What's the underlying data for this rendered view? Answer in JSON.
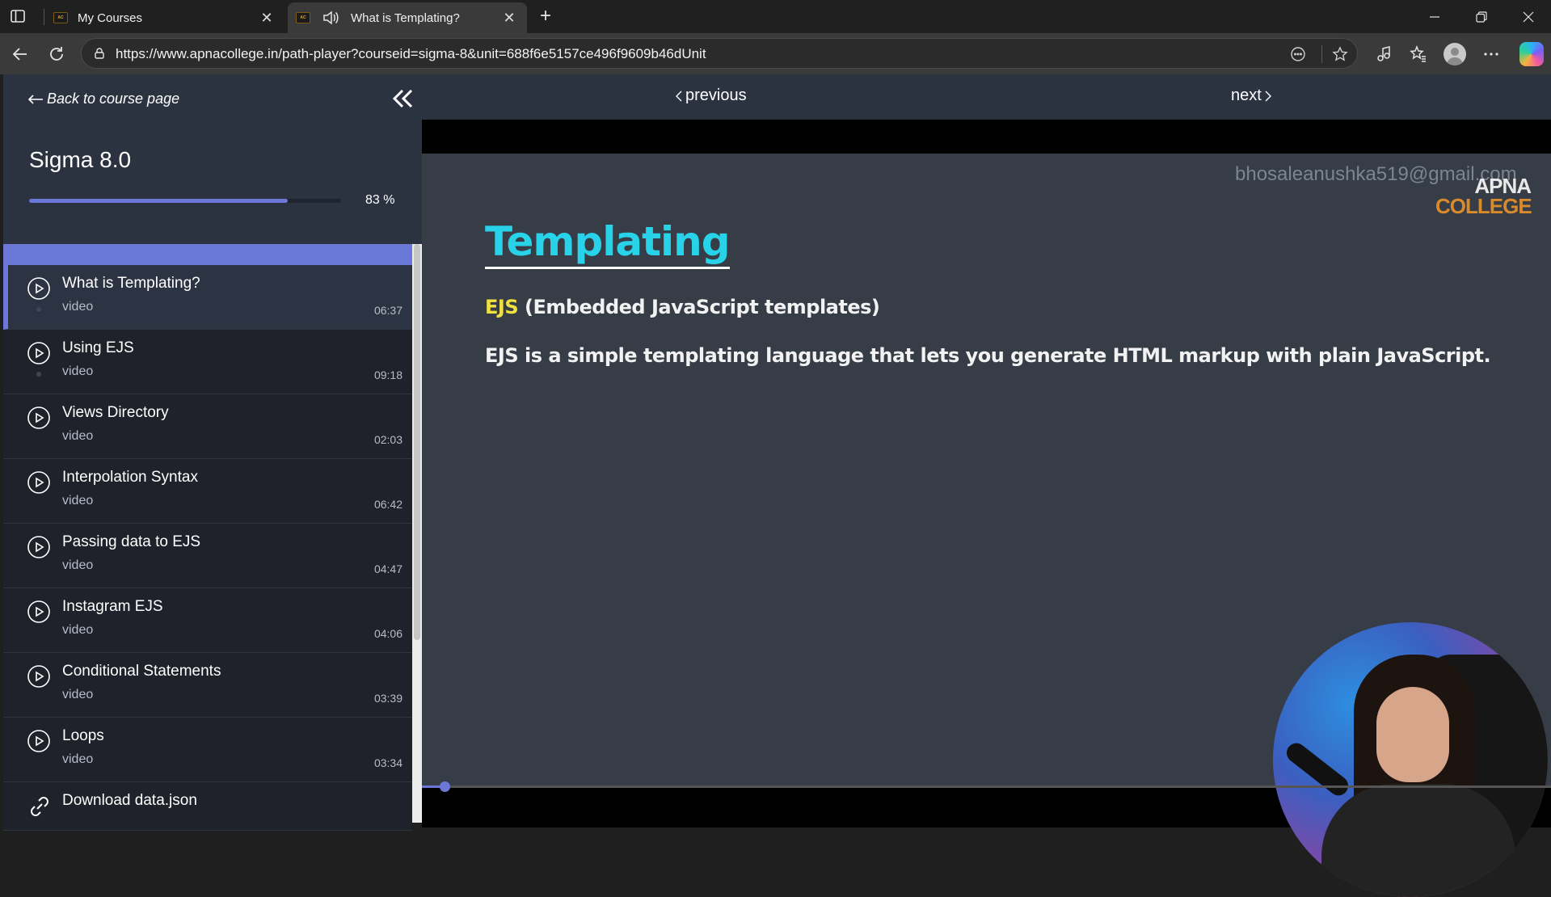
{
  "browser": {
    "tabs": [
      {
        "title": "My Courses",
        "favicon": "apna-college-favicon",
        "active": false
      },
      {
        "title": "What is Templating?",
        "favicon": "apna-college-favicon",
        "active": true,
        "audio": "speaker-icon"
      }
    ],
    "url": "https://www.apnacollege.in/path-player?courseid=sigma-8&unit=688f6e5157ce496f9609b46dUnit"
  },
  "sidebar": {
    "back_label": "Back to course page",
    "course_title": "Sigma 8.0",
    "progress": 0.83,
    "progress_label": "83 %",
    "lessons": [
      {
        "title": "What is Templating?",
        "type": "video",
        "duration": "06:37",
        "active": true
      },
      {
        "title": "Using EJS",
        "type": "video",
        "duration": "09:18"
      },
      {
        "title": "Views Directory",
        "type": "video",
        "duration": "02:03"
      },
      {
        "title": "Interpolation Syntax",
        "type": "video",
        "duration": "06:42"
      },
      {
        "title": "Passing data to EJS",
        "type": "video",
        "duration": "04:47"
      },
      {
        "title": "Instagram EJS",
        "type": "video",
        "duration": "04:06"
      },
      {
        "title": "Conditional Statements",
        "type": "video",
        "duration": "03:39"
      },
      {
        "title": "Loops",
        "type": "video",
        "duration": "03:34"
      },
      {
        "title": "Download data.json"
      }
    ]
  },
  "player": {
    "previous_label": "previous",
    "next_label": "next",
    "watermark": "bhosaleanushka519@gmail.com",
    "brand_line1": "APNA",
    "brand_line2": "COLLEGE",
    "slide_heading": "Templating",
    "slide_ejs": "EJS",
    "slide_ejs_desc": "(Embedded JavaScript templates)",
    "slide_body": "EJS is a simple templating language that lets you generate HTML markup with plain JavaScript.",
    "video_progress": 0.02
  },
  "colors": {
    "accent": "#6c78d8",
    "heading": "#28d3ea",
    "highlight": "#f0e040",
    "brand_orange": "#d98a2b"
  }
}
